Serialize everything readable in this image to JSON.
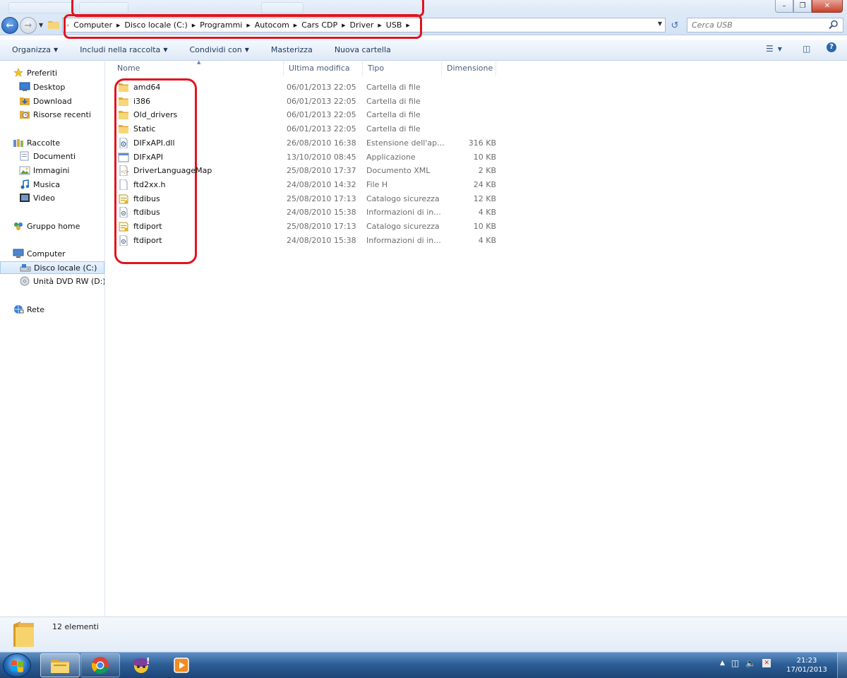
{
  "address": {
    "crumbs": [
      "Computer",
      "Disco locale (C:)",
      "Programmi",
      "Autocom",
      "Cars CDP",
      "Driver",
      "USB"
    ]
  },
  "search": {
    "placeholder": "Cerca USB"
  },
  "toolbar": {
    "items": [
      {
        "label": "Organizza",
        "dropdown": true
      },
      {
        "label": "Includi nella raccolta",
        "dropdown": true
      },
      {
        "label": "Condividi con",
        "dropdown": true
      },
      {
        "label": "Masterizza",
        "dropdown": false
      },
      {
        "label": "Nuova cartella",
        "dropdown": false
      }
    ]
  },
  "sidebar": {
    "items": [
      {
        "label": "Preferiti",
        "icon": "star-icon"
      },
      {
        "label": "Desktop",
        "icon": "desktop-icon"
      },
      {
        "label": "Download",
        "icon": "download-folder-icon"
      },
      {
        "label": "Risorse recenti",
        "icon": "recent-places-icon"
      },
      {
        "label": "Raccolte",
        "icon": "libraries-icon"
      },
      {
        "label": "Documenti",
        "icon": "documents-icon"
      },
      {
        "label": "Immagini",
        "icon": "pictures-icon"
      },
      {
        "label": "Musica",
        "icon": "music-icon"
      },
      {
        "label": "Video",
        "icon": "video-icon"
      },
      {
        "label": "Gruppo home",
        "icon": "homegroup-icon"
      },
      {
        "label": "Computer",
        "icon": "computer-icon"
      },
      {
        "label": "Disco locale (C:)",
        "icon": "drive-icon"
      },
      {
        "label": "Unità DVD RW (D:) M",
        "icon": "dvd-drive-icon"
      },
      {
        "label": "Rete",
        "icon": "network-icon"
      }
    ]
  },
  "columns": {
    "name": "Nome",
    "modified": "Ultima modifica",
    "type": "Tipo",
    "size": "Dimensione"
  },
  "files": [
    {
      "name": "amd64",
      "modified": "06/01/2013 22:05",
      "type": "Cartella di file",
      "size": "",
      "icon": "folder-icon"
    },
    {
      "name": "i386",
      "modified": "06/01/2013 22:05",
      "type": "Cartella di file",
      "size": "",
      "icon": "folder-icon"
    },
    {
      "name": "Old_drivers",
      "modified": "06/01/2013 22:05",
      "type": "Cartella di file",
      "size": "",
      "icon": "folder-icon"
    },
    {
      "name": "Static",
      "modified": "06/01/2013 22:05",
      "type": "Cartella di file",
      "size": "",
      "icon": "folder-icon"
    },
    {
      "name": "DIFxAPI.dll",
      "modified": "26/08/2010 16:38",
      "type": "Estensione dell'ap...",
      "size": "316 KB",
      "icon": "dll-file-icon"
    },
    {
      "name": "DIFxAPI",
      "modified": "13/10/2010 08:45",
      "type": "Applicazione",
      "size": "10 KB",
      "icon": "application-icon"
    },
    {
      "name": "DriverLanguageMap",
      "modified": "25/08/2010 17:37",
      "type": "Documento XML",
      "size": "2 KB",
      "icon": "xml-file-icon"
    },
    {
      "name": "ftd2xx.h",
      "modified": "24/08/2010 14:32",
      "type": "File H",
      "size": "24 KB",
      "icon": "blank-file-icon"
    },
    {
      "name": "ftdibus",
      "modified": "25/08/2010 17:13",
      "type": "Catalogo sicurezza",
      "size": "12 KB",
      "icon": "security-catalog-icon"
    },
    {
      "name": "ftdibus",
      "modified": "24/08/2010 15:38",
      "type": "Informazioni di in...",
      "size": "4 KB",
      "icon": "setup-info-icon"
    },
    {
      "name": "ftdiport",
      "modified": "25/08/2010 17:13",
      "type": "Catalogo sicurezza",
      "size": "10 KB",
      "icon": "security-catalog-icon"
    },
    {
      "name": "ftdiport",
      "modified": "24/08/2010 15:38",
      "type": "Informazioni di in...",
      "size": "4 KB",
      "icon": "setup-info-icon"
    }
  ],
  "status": {
    "count": "12 elementi"
  },
  "clock": {
    "time": "21:23",
    "date": "17/01/2013"
  },
  "colors": {
    "annotation_red": "#e0141e",
    "selection": "#d4e7fb"
  }
}
